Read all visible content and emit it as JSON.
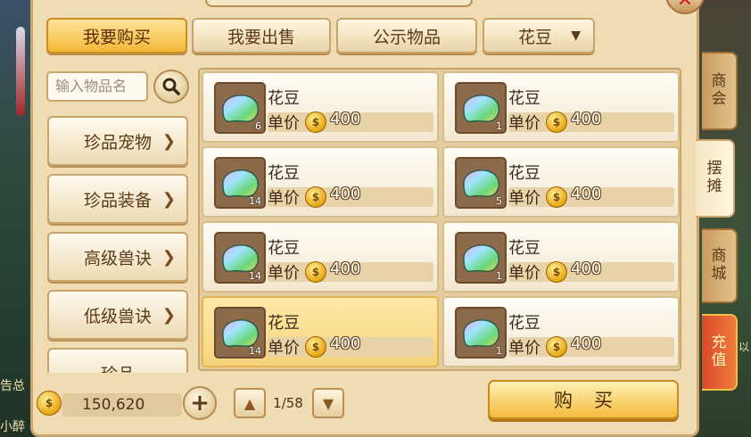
{
  "tabs": {
    "buy": "我要购买",
    "sell": "我要出售",
    "public": "公示物品"
  },
  "filter": {
    "selected": "花豆",
    "arrow": "▼"
  },
  "search": {
    "placeholder": "输入物品名"
  },
  "categories": [
    "珍品宠物",
    "珍品装备",
    "高级兽诀",
    "低级兽诀",
    "珍品"
  ],
  "items": [
    {
      "name": "花豆",
      "price_label": "单价",
      "price": "400",
      "count": "6",
      "selected": false
    },
    {
      "name": "花豆",
      "price_label": "单价",
      "price": "400",
      "count": "1",
      "selected": false
    },
    {
      "name": "花豆",
      "price_label": "单价",
      "price": "400",
      "count": "14",
      "selected": false
    },
    {
      "name": "花豆",
      "price_label": "单价",
      "price": "400",
      "count": "5",
      "selected": false
    },
    {
      "name": "花豆",
      "price_label": "单价",
      "price": "400",
      "count": "14",
      "selected": false
    },
    {
      "name": "花豆",
      "price_label": "单价",
      "price": "400",
      "count": "1",
      "selected": false
    },
    {
      "name": "花豆",
      "price_label": "单价",
      "price": "400",
      "count": "14",
      "selected": true
    },
    {
      "name": "花豆",
      "price_label": "单价",
      "price": "400",
      "count": "1",
      "selected": false
    }
  ],
  "side_tabs": [
    {
      "label": "商\n会",
      "style": "tan"
    },
    {
      "label": "摆\n摊",
      "style": "active"
    },
    {
      "label": "商\n城",
      "style": "tan"
    },
    {
      "label": "充\n值",
      "style": "red"
    }
  ],
  "bottom": {
    "money": "150,620",
    "plus": "+",
    "page": "1/58",
    "prev": "^",
    "next": "v",
    "buy_label": "购买"
  },
  "background_text": {
    "left1": "告总",
    "left2": "小醉",
    "right": "以"
  },
  "colors": {
    "accent": "#f3b938",
    "panel": "#efdcb2",
    "border": "#c9a56e"
  }
}
